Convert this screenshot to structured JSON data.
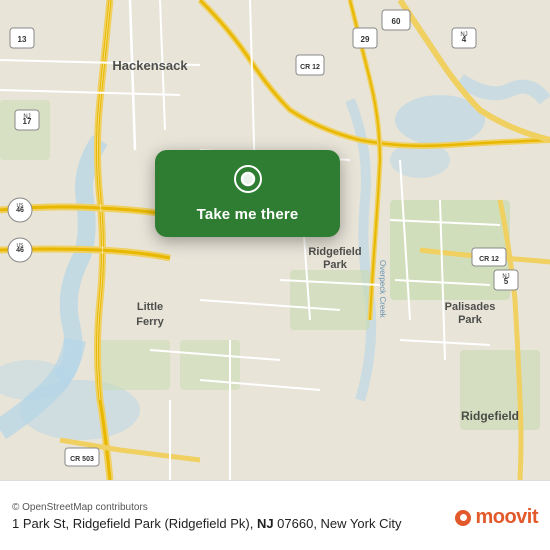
{
  "map": {
    "alt": "Street map of Ridgefield Park area, New Jersey, New York City",
    "popup_label": "Take me there",
    "pin_icon": "location-pin"
  },
  "info_bar": {
    "osm_credit": "© OpenStreetMap contributors",
    "address": "1 Park St, Ridgefield Park (Ridgefield Pk), <B>NJ</B> 07660, New York City",
    "address_display": "1 Park St, Ridgefield Park (Ridgefield Pk), NJ 07660, New York City"
  },
  "moovit": {
    "brand": "moovit"
  }
}
